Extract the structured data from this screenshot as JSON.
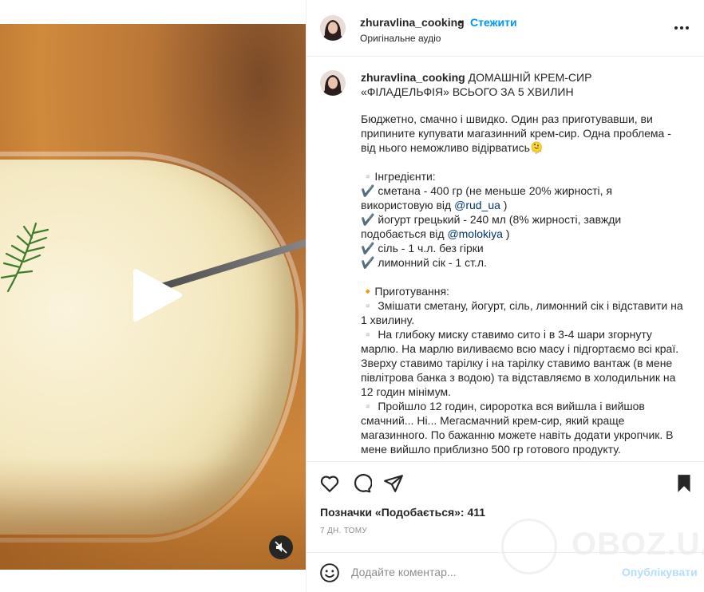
{
  "header": {
    "username": "zhuravlina_cooking",
    "separator": "•",
    "follow_label": "Стежити",
    "audio_label": "Оригінальне аудіо",
    "more_icon": "more-horizontal-icon"
  },
  "caption": {
    "username": "zhuravlina_cooking",
    "title": "ДОМАШНІЙ КРЕМ-СИР «ФІЛАДЕЛЬФІЯ» ВСЬОГО ЗА 5 ХВИЛИН",
    "intro": "Бюджетно, смачно і швидко. Один раз приготувавши, ви припините купувати магазинний крем-сир. Одна проблема - від нього неможливо відірватись🫠",
    "ingredients_title": "▫️Інгредієнти:",
    "ingredients": [
      {
        "text": "✔️ сметана - 400 гр (не меньше 20% жирності, я використовую від ",
        "mention": "@rud_ua",
        "after": " )"
      },
      {
        "text": "✔️ йогурт грецький - 240 мл (8% жирності, завжди подобається від ",
        "mention": "@molokiya",
        "after": " )"
      },
      {
        "text": "✔️ сіль - 1 ч.л. без гірки",
        "mention": "",
        "after": ""
      },
      {
        "text": "✔️ лимонний сік - 1 ст.л.",
        "mention": "",
        "after": ""
      }
    ],
    "steps_title": "🔸Приготування:",
    "steps": [
      "▫️ Змішати сметану, йогурт, сіль, лимонний сік і відставити на 1 хвилину.",
      "▫️ На глибоку миску ставимо сито і в 3-4 шари згорнуту марлю. На марлю виливаємо всю масу і підгортаємо всі краї. Зверху ставимо тарілку і на тарілку ставимо вантаж (в мене півлітрова банка з водою) та відставляємо в холодильник на 12 годин мінімум.",
      "▫️ Пройшло 12 годин, сироротка вся вийшла і вийшов смачний... Ні... Мегасмачний крем-сир, який краще магазинного. По бажанню можете навіть додати укропчик. В мене вийшло приблизно 500 гр готового продукту."
    ]
  },
  "actions": {
    "like_icon": "heart-icon",
    "comment_icon": "comment-icon",
    "share_icon": "send-icon",
    "save_icon": "bookmark-icon"
  },
  "likes_text": "Позначки «Подобається»: 411",
  "date_text": "7 ДН. ТОМУ",
  "comment": {
    "placeholder": "Додайте коментар...",
    "publish_label": "Опублікувати",
    "emoji_icon": "emoji-icon"
  },
  "media": {
    "play_icon": "play-icon",
    "mute_icon": "mute-icon"
  },
  "watermark": {
    "text": "OBOZ.UA"
  },
  "colors": {
    "accent": "#0095f6",
    "text": "#262626",
    "muted": "#8e8e8e",
    "publish_disabled": "#b2dffc"
  }
}
